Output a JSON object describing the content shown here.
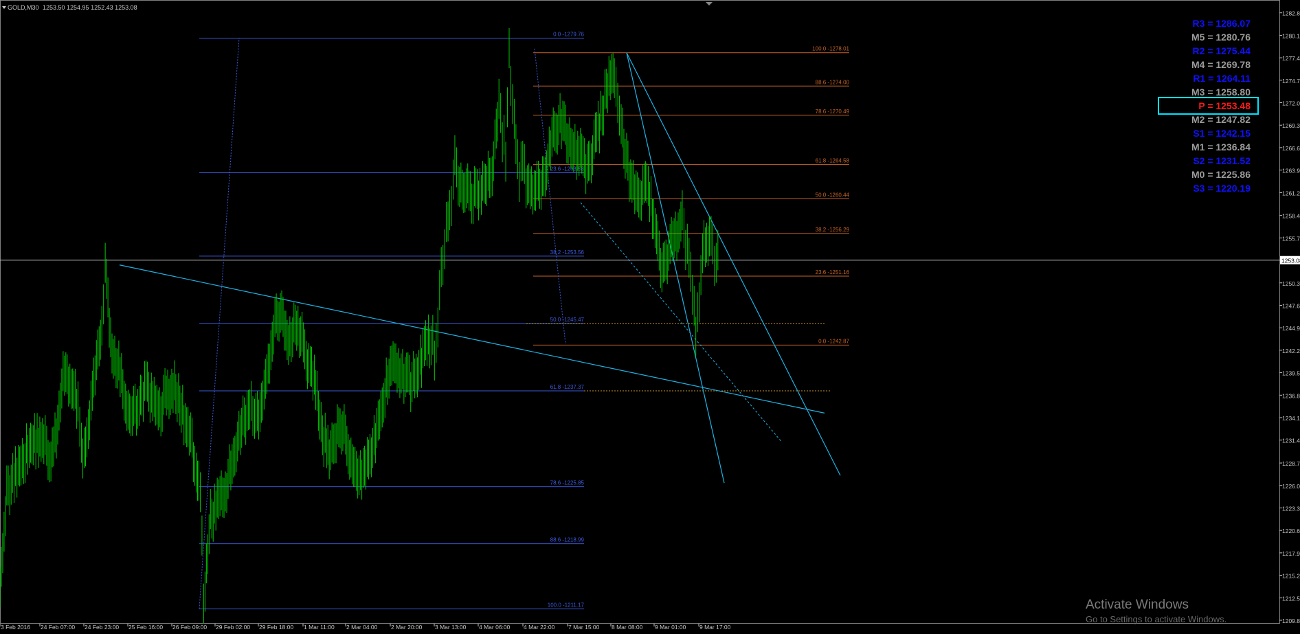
{
  "window": {
    "symbol_header": "GOLD,M30",
    "ohlc": "1253.50 1254.95 1252.43 1253.08",
    "watermark_title": "Activate Windows",
    "watermark_sub": "Go to Settings to activate Windows."
  },
  "colors": {
    "background": "#000000",
    "candles": "#00c800",
    "axis": "#c8c8c8",
    "fib_retracement": "#3c5adc",
    "fib_extension": "#c86428",
    "trendline": "#1eb4e6",
    "pivot_box": "#00e5ff",
    "pivot_text": "#ff1a1a",
    "resist_support_text": "#1010ff",
    "mid_text": "#9a9a9a"
  },
  "chart_data": {
    "type": "candlestick",
    "title": "GOLD,M30",
    "ylim": [
      1209.8,
      1283.6
    ],
    "y_ticks": [
      "1282.80",
      "1280.10",
      "1277.40",
      "1274.70",
      "1272.00",
      "1269.30",
      "1266.60",
      "1263.90",
      "1261.20",
      "1258.45",
      "1255.75",
      "1253.08",
      "1250.35",
      "1247.65",
      "1244.95",
      "1242.25",
      "1239.55",
      "1236.85",
      "1234.15",
      "1231.45",
      "1228.70",
      "1226.00",
      "1223.30",
      "1220.60",
      "1217.90",
      "1215.20",
      "1212.50",
      "1209.80"
    ],
    "current_price": "1253.08",
    "x_ticks": [
      "3 Feb 2016",
      "24 Feb 07:00",
      "24 Feb 23:00",
      "25 Feb 16:00",
      "26 Feb 09:00",
      "29 Feb 02:00",
      "29 Feb 18:00",
      "1 Mar 11:00",
      "2 Mar 04:00",
      "2 Mar 20:00",
      "3 Mar 13:00",
      "4 Mar 06:00",
      "4 Mar 22:00",
      "7 Mar 15:00",
      "8 Mar 08:00",
      "9 Mar 01:00",
      "9 Mar 17:00"
    ],
    "price_path": [
      [
        0,
        1215
      ],
      [
        4,
        1225
      ],
      [
        10,
        1228
      ],
      [
        18,
        1231
      ],
      [
        25,
        1232
      ],
      [
        30,
        1229
      ],
      [
        34,
        1233
      ],
      [
        38,
        1240
      ],
      [
        42,
        1238
      ],
      [
        46,
        1236
      ],
      [
        48,
        1230
      ],
      [
        52,
        1232
      ],
      [
        56,
        1240
      ],
      [
        60,
        1244
      ],
      [
        62,
        1252
      ],
      [
        66,
        1242
      ],
      [
        70,
        1240
      ],
      [
        74,
        1236
      ],
      [
        78,
        1234
      ],
      [
        82,
        1236
      ],
      [
        86,
        1238
      ],
      [
        90,
        1236
      ],
      [
        94,
        1235
      ],
      [
        98,
        1237
      ],
      [
        102,
        1238
      ],
      [
        106,
        1236
      ],
      [
        110,
        1233
      ],
      [
        114,
        1230
      ],
      [
        118,
        1226
      ],
      [
        120,
        1212
      ],
      [
        124,
        1222
      ],
      [
        128,
        1224
      ],
      [
        132,
        1225
      ],
      [
        136,
        1228
      ],
      [
        140,
        1232
      ],
      [
        144,
        1234
      ],
      [
        148,
        1235
      ],
      [
        150,
        1233
      ],
      [
        154,
        1236
      ],
      [
        158,
        1240
      ],
      [
        162,
        1246
      ],
      [
        166,
        1246
      ],
      [
        170,
        1243
      ],
      [
        174,
        1246
      ],
      [
        178,
        1244
      ],
      [
        182,
        1240
      ],
      [
        186,
        1238
      ],
      [
        190,
        1232
      ],
      [
        194,
        1230
      ],
      [
        198,
        1232
      ],
      [
        202,
        1233
      ],
      [
        206,
        1230
      ],
      [
        210,
        1227
      ],
      [
        214,
        1228
      ],
      [
        218,
        1230
      ],
      [
        222,
        1232
      ],
      [
        226,
        1236
      ],
      [
        230,
        1241
      ],
      [
        234,
        1240
      ],
      [
        238,
        1239
      ],
      [
        242,
        1238
      ],
      [
        246,
        1240
      ],
      [
        250,
        1242
      ],
      [
        254,
        1244
      ],
      [
        256,
        1242
      ],
      [
        258,
        1246
      ],
      [
        260,
        1252
      ],
      [
        262,
        1255
      ],
      [
        264,
        1258
      ],
      [
        266,
        1260
      ],
      [
        268,
        1266
      ],
      [
        270,
        1262
      ],
      [
        274,
        1262
      ],
      [
        278,
        1261
      ],
      [
        282,
        1261
      ],
      [
        286,
        1262
      ],
      [
        290,
        1264
      ],
      [
        294,
        1272
      ],
      [
        296,
        1268
      ],
      [
        298,
        1266
      ],
      [
        300,
        1278
      ],
      [
        302,
        1272
      ],
      [
        304,
        1268
      ],
      [
        306,
        1263
      ],
      [
        308,
        1266
      ],
      [
        310,
        1262
      ],
      [
        314,
        1261
      ],
      [
        318,
        1262
      ],
      [
        322,
        1264
      ],
      [
        326,
        1268
      ],
      [
        330,
        1270
      ],
      [
        334,
        1268
      ],
      [
        338,
        1266
      ],
      [
        342,
        1266
      ],
      [
        346,
        1264
      ],
      [
        350,
        1267
      ],
      [
        354,
        1270
      ],
      [
        358,
        1274
      ],
      [
        362,
        1276
      ],
      [
        364,
        1272
      ],
      [
        366,
        1270
      ],
      [
        370,
        1264
      ],
      [
        374,
        1262
      ],
      [
        378,
        1261
      ],
      [
        382,
        1262
      ],
      [
        386,
        1256
      ],
      [
        390,
        1252
      ],
      [
        394,
        1254
      ],
      [
        398,
        1256
      ],
      [
        402,
        1258
      ],
      [
        404,
        1255
      ],
      [
        406,
        1253
      ],
      [
        408,
        1250
      ],
      [
        410,
        1245
      ],
      [
        412,
        1248
      ],
      [
        414,
        1254
      ],
      [
        418,
        1256
      ],
      [
        420,
        1254
      ],
      [
        422,
        1253
      ],
      [
        424,
        1254
      ]
    ],
    "fib_retracement": {
      "levels": [
        {
          "label": "0.0 -1279.76",
          "value": 1279.76
        },
        {
          "label": "23.6 -1263.58",
          "value": 1263.58
        },
        {
          "label": "38.2 -1253.56",
          "value": 1253.56
        },
        {
          "label": "50.0 -1245.47",
          "value": 1245.47
        },
        {
          "label": "61.8 -1237.37",
          "value": 1237.37
        },
        {
          "label": "78.6 -1225.85",
          "value": 1225.85
        },
        {
          "label": "88.6 -1218.99",
          "value": 1218.99
        },
        {
          "label": "100.0 -1211.17",
          "value": 1211.17
        }
      ]
    },
    "fib_extension": {
      "levels": [
        {
          "label": "100.0 -1278.01",
          "value": 1278.01
        },
        {
          "label": "88.6 -1274.00",
          "value": 1274.0
        },
        {
          "label": "78.6 -1270.49",
          "value": 1270.49
        },
        {
          "label": "61.8 -1264.58",
          "value": 1264.58
        },
        {
          "label": "50.0 -1260.44",
          "value": 1260.44
        },
        {
          "label": "38.2 -1256.29",
          "value": 1256.29
        },
        {
          "label": "23.6 -1251.16",
          "value": 1251.16
        },
        {
          "label": "0.0 -1242.87",
          "value": 1242.87
        }
      ]
    },
    "pivots": [
      {
        "name": "R3",
        "label": "R3 = 1286.07",
        "kind": "r"
      },
      {
        "name": "M5",
        "label": "M5 = 1280.76",
        "kind": "m"
      },
      {
        "name": "R2",
        "label": "R2 = 1275.44",
        "kind": "r"
      },
      {
        "name": "M4",
        "label": "M4 = 1269.78",
        "kind": "m"
      },
      {
        "name": "R1",
        "label": "R1 = 1264.11",
        "kind": "r"
      },
      {
        "name": "M3",
        "label": "M3 = 1258.80",
        "kind": "m"
      },
      {
        "name": "P",
        "label": "P  = 1253.48",
        "kind": "p"
      },
      {
        "name": "M2",
        "label": "M2 = 1247.82",
        "kind": "m"
      },
      {
        "name": "S1",
        "label": "S1 = 1242.15",
        "kind": "r"
      },
      {
        "name": "M1",
        "label": "M1 = 1236.84",
        "kind": "m"
      },
      {
        "name": "S2",
        "label": "S2 = 1231.52",
        "kind": "r"
      },
      {
        "name": "M0",
        "label": "M0 = 1225.86",
        "kind": "m"
      },
      {
        "name": "S3",
        "label": "S3 = 1220.19",
        "kind": "r"
      }
    ]
  }
}
